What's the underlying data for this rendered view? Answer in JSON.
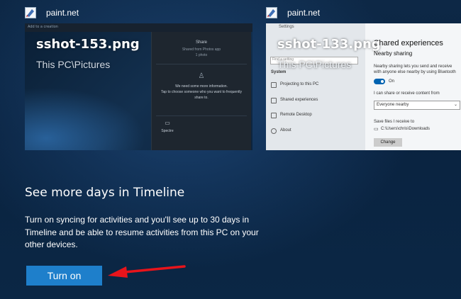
{
  "cards": [
    {
      "app_name": "paint.net",
      "file_name": "sshot-153.png",
      "location": "This PC\\Pictures",
      "preview": {
        "toolbar_text": "Add to a creation",
        "share_title": "Share",
        "share_sub": "Shared from Photos app",
        "share_count": "1 photo",
        "info_line1": "We need some more information.",
        "info_line2": "Tap to choose someone who you want to frequently",
        "info_line3": "share to.",
        "app_label": "Spectre"
      }
    },
    {
      "app_name": "paint.net",
      "file_name": "sshot-133.png",
      "location": "This PC\\Pictures",
      "preview": {
        "back_label": "Settings",
        "find_placeholder": "Find a setting",
        "system_label": "System",
        "items": [
          "Projecting to this PC",
          "Shared experiences",
          "Remote Desktop",
          "About"
        ],
        "heading": "Shared experiences",
        "subheading": "Nearby sharing",
        "desc1": "Nearby sharing lets you send and receive",
        "desc2": "with anyone else nearby by using Bluetooth",
        "toggle_label": "On",
        "share_from": "I can share or receive content from",
        "dropdown_value": "Everyone nearby",
        "save_to": "Save files I receive to",
        "path": "C:\\Users\\chris\\Downloads",
        "change_label": "Change"
      }
    }
  ],
  "timeline": {
    "title": "See more days in Timeline",
    "description": "Turn on syncing for activities and you'll see up to 30 days in Timeline and be able to resume activities from this PC on your other devices.",
    "button_label": "Turn on"
  },
  "colors": {
    "accent_button": "#1e7fcb",
    "annotation_arrow": "#e8141b"
  }
}
